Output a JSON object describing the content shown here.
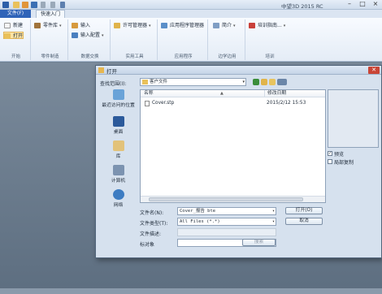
{
  "app": {
    "title": "中望3D 2015 RC",
    "tabs": [
      "文件(F)",
      "快速入门"
    ]
  },
  "ribbon": {
    "groups": [
      {
        "label": "开始",
        "items": [
          "新建",
          "打开"
        ]
      },
      {
        "label": "零件制造",
        "items": [
          "零件库"
        ]
      },
      {
        "label": "数据交换",
        "items": [
          "输入",
          "输入配置"
        ]
      },
      {
        "label": "实用工具",
        "items": [
          "许可管理器"
        ]
      },
      {
        "label": "应用程序",
        "items": [
          "应用程序管理器"
        ]
      },
      {
        "label": "边学边用",
        "items": [
          "简介"
        ]
      },
      {
        "label": "培训",
        "items": [
          "培训指南..."
        ]
      }
    ]
  },
  "dialog": {
    "title": "打开",
    "close": "✕",
    "look_in_label": "查找范围(I):",
    "look_in_value": "客户文件",
    "places": [
      "最近访问的位置",
      "桌面",
      "库",
      "计算机",
      "网络"
    ],
    "columns": [
      "名称",
      "修改日期"
    ],
    "files": [
      {
        "name": "Cover.stp",
        "date": "2015/2/12 15:53"
      }
    ],
    "preview_label": "预览",
    "preview_checked": true,
    "copy_label": "局部复制",
    "copy_checked": false,
    "filename_label": "文件名(N):",
    "filename_value": "Cover_报告 bte",
    "filetype_label": "文件类型(T):",
    "filetype_value": "All Files (*.*)",
    "desc_label": "文件描述:",
    "desc_value": "",
    "object_label": "标对象",
    "object_value": "",
    "search_label": "搜索",
    "open_label": "打开(O)",
    "cancel_label": "取消"
  },
  "colors": {
    "accent": "#2f63b8",
    "workspace": "#6f8192",
    "dialog_bg": "#d6e1ee"
  }
}
